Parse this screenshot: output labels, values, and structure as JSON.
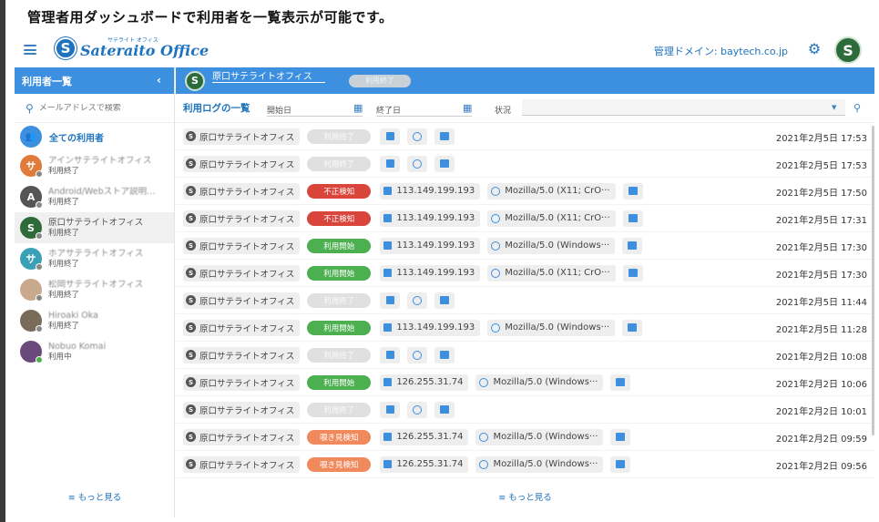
{
  "caption": "管理者用ダッシュボードで利用者を一覧表示が可能です。",
  "header": {
    "logo_letter": "S",
    "logo_kana": "サテライト オフィス",
    "logo_name": "Sateraito Office",
    "domain_label": "管理ドメイン: baytech.co.jp",
    "avatar_letter": "S"
  },
  "sidebar": {
    "title": "利用者一覧",
    "collapse_glyph": "‹",
    "search_placeholder": "メールアドレスで検索",
    "all_users_label": "全ての利用者",
    "users": [
      {
        "initial": "サ",
        "name": "アインサテライトオフィス",
        "status": "利用終了",
        "color": "#e07b3a",
        "dot": "gray",
        "blur": true
      },
      {
        "initial": "A",
        "name": "Android/Webストア説明…",
        "status": "利用終了",
        "color": "#555555",
        "dot": "gray",
        "blur": true
      },
      {
        "initial": "S",
        "name": "原口サテライトオフィス",
        "status": "利用終了",
        "color": "#2e6b3a",
        "dot": "gray",
        "blur": false
      },
      {
        "initial": "サ",
        "name": "ホアサテライトオフィス",
        "status": "利用終了",
        "color": "#3aa0b5",
        "dot": "gray",
        "blur": true
      },
      {
        "initial": "",
        "name": "松岡サテライトオフィス",
        "status": "利用終了",
        "color": "#c9a98c",
        "dot": "gray",
        "blur": true
      },
      {
        "initial": "",
        "name": "Hiroaki Oka",
        "status": "利用終了",
        "color": "#7a6a5a",
        "dot": "gray",
        "blur": true
      },
      {
        "initial": "",
        "name": "Nobuo Komai",
        "status": "利用中",
        "color": "#6a4a7a",
        "dot": "green",
        "blur": true
      }
    ],
    "more_label": "もっと見る"
  },
  "main": {
    "selected_user": "原口サテライトオフィス",
    "selected_badge": "利用終了",
    "filter": {
      "title": "利用ログの一覧",
      "start_label": "開始日",
      "end_label": "終了日",
      "status_label": "状況"
    },
    "rows": [
      {
        "user": "原口サテライトオフィス",
        "status": "利用終了",
        "kind": "end",
        "ip": "",
        "ua": "",
        "time": "2021年2月5日 17:53"
      },
      {
        "user": "原口サテライトオフィス",
        "status": "利用終了",
        "kind": "end",
        "ip": "",
        "ua": "",
        "time": "2021年2月5日 17:53"
      },
      {
        "user": "原口サテライトオフィス",
        "status": "不正検知",
        "kind": "fraud",
        "ip": "113.149.199.193",
        "ua": "Mozilla/5.0 (X11; CrO···",
        "time": "2021年2月5日 17:50"
      },
      {
        "user": "原口サテライトオフィス",
        "status": "不正検知",
        "kind": "fraud",
        "ip": "113.149.199.193",
        "ua": "Mozilla/5.0 (X11; CrO···",
        "time": "2021年2月5日 17:31"
      },
      {
        "user": "原口サテライトオフィス",
        "status": "利用開始",
        "kind": "start",
        "ip": "113.149.199.193",
        "ua": "Mozilla/5.0 (Windows···",
        "time": "2021年2月5日 17:30"
      },
      {
        "user": "原口サテライトオフィス",
        "status": "利用開始",
        "kind": "start",
        "ip": "113.149.199.193",
        "ua": "Mozilla/5.0 (X11; CrO···",
        "time": "2021年2月5日 17:30"
      },
      {
        "user": "原口サテライトオフィス",
        "status": "利用終了",
        "kind": "end",
        "ip": "",
        "ua": "",
        "time": "2021年2月5日 11:44"
      },
      {
        "user": "原口サテライトオフィス",
        "status": "利用開始",
        "kind": "start",
        "ip": "113.149.199.193",
        "ua": "Mozilla/5.0 (Windows···",
        "time": "2021年2月5日 11:28"
      },
      {
        "user": "原口サテライトオフィス",
        "status": "利用終了",
        "kind": "end",
        "ip": "",
        "ua": "",
        "time": "2021年2月2日 10:08"
      },
      {
        "user": "原口サテライトオフィス",
        "status": "利用開始",
        "kind": "start",
        "ip": "126.255.31.74",
        "ua": "Mozilla/5.0 (Windows···",
        "time": "2021年2月2日 10:06"
      },
      {
        "user": "原口サテライトオフィス",
        "status": "利用終了",
        "kind": "end",
        "ip": "",
        "ua": "",
        "time": "2021年2月2日 10:01"
      },
      {
        "user": "原口サテライトオフィス",
        "status": "覗き見検知",
        "kind": "peek",
        "ip": "126.255.31.74",
        "ua": "Mozilla/5.0 (Windows···",
        "time": "2021年2月2日 09:59"
      },
      {
        "user": "原口サテライトオフィス",
        "status": "覗き見検知",
        "kind": "peek",
        "ip": "126.255.31.74",
        "ua": "Mozilla/5.0 (Windows···",
        "time": "2021年2月2日 09:56"
      }
    ],
    "more_label": "もっと見る"
  },
  "colors": {
    "accent": "#3d8fe0",
    "brand": "#1e73be",
    "fraud": "#d9453b",
    "start": "#4caf50",
    "peek": "#f08a5d",
    "end": "#e0e0e0"
  },
  "icons": {
    "menu": "hamburger-icon",
    "settings": "gear-icon",
    "search": "search-icon",
    "calendar": "calendar-icon",
    "ip": "ip-address-icon",
    "user_agent": "browser-icon",
    "screenshot": "image-icon",
    "more": "list-icon"
  }
}
